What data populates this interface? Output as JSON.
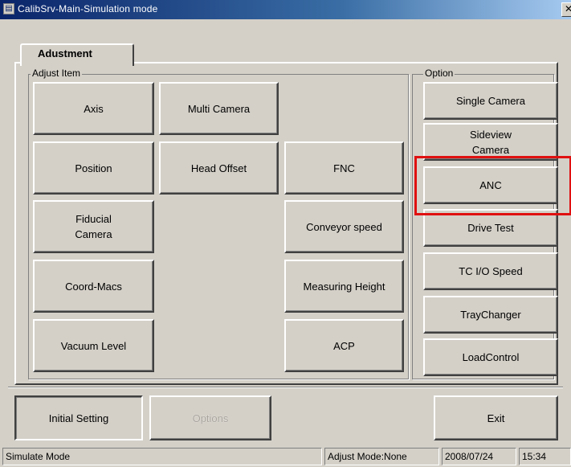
{
  "window": {
    "title": "CalibSrv-Main-Simulation mode",
    "close_glyph": "✕"
  },
  "tab": {
    "label": "Adustment"
  },
  "adjust_group": {
    "label": "Adjust Item"
  },
  "option_group": {
    "label": "Option"
  },
  "buttons": {
    "axis": "Axis",
    "multi_camera": "Multi Camera",
    "position": "Position",
    "head_offset": "Head Offset",
    "fnc": "FNC",
    "fiducial_camera": "Fiducial Camera",
    "conveyor_speed": "Conveyor speed",
    "coord_macs": "Coord-Macs",
    "measuring_height": "Measuring Height",
    "vacuum_level": "Vacuum Level",
    "acp": "ACP",
    "single_camera": "Single Camera",
    "sideview_camera": "Sideview Camera",
    "anc": "ANC",
    "drive_test": "Drive Test",
    "tc_io_speed": "TC I/O Speed",
    "tray_changer": "TrayChanger",
    "load_control": "LoadControl"
  },
  "bottom": {
    "initial_setting": "Initial Setting",
    "options": "Options",
    "exit": "Exit"
  },
  "status": {
    "mode": "Simulate Mode",
    "adjust_mode": "Adjust Mode:None",
    "date": "2008/07/24",
    "time": "15:34"
  },
  "colors": {
    "highlight": "#e01010",
    "titlebar": "#0a246a"
  }
}
